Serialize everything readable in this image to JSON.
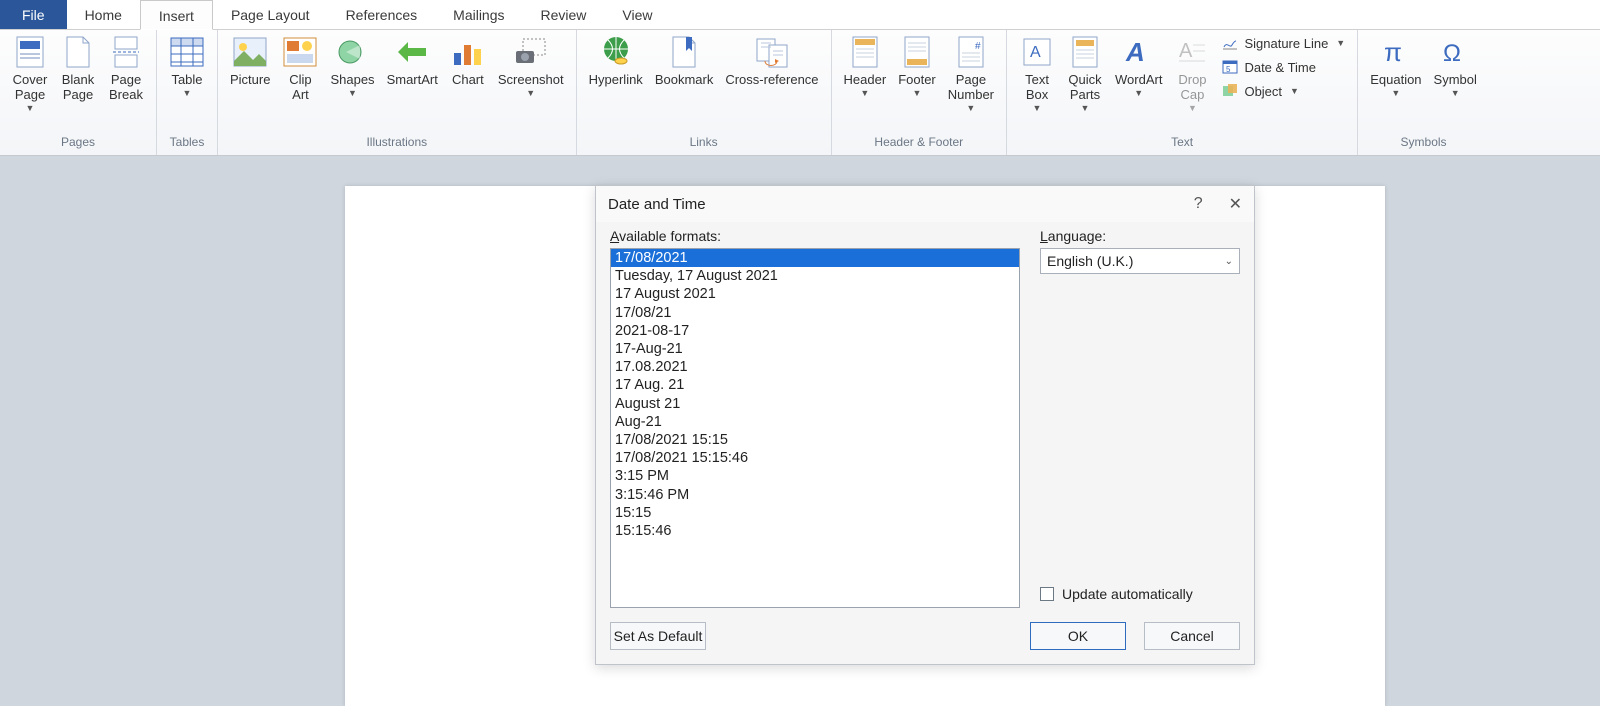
{
  "tabs": {
    "file": "File",
    "home": "Home",
    "insert": "Insert",
    "page_layout": "Page Layout",
    "references": "References",
    "mailings": "Mailings",
    "review": "Review",
    "view": "View"
  },
  "ribbon": {
    "pages": {
      "label": "Pages",
      "cover_page": "Cover\nPage",
      "blank_page": "Blank\nPage",
      "page_break": "Page\nBreak"
    },
    "tables": {
      "label": "Tables",
      "table": "Table"
    },
    "illustrations": {
      "label": "Illustrations",
      "picture": "Picture",
      "clip_art": "Clip\nArt",
      "shapes": "Shapes",
      "smartart": "SmartArt",
      "chart": "Chart",
      "screenshot": "Screenshot"
    },
    "links": {
      "label": "Links",
      "hyperlink": "Hyperlink",
      "bookmark": "Bookmark",
      "cross_ref": "Cross-reference"
    },
    "header_footer": {
      "label": "Header & Footer",
      "header": "Header",
      "footer": "Footer",
      "page_number": "Page\nNumber"
    },
    "text": {
      "label": "Text",
      "text_box": "Text\nBox",
      "quick_parts": "Quick\nParts",
      "wordart": "WordArt",
      "drop_cap": "Drop\nCap",
      "signature_line": "Signature Line",
      "date_time": "Date & Time",
      "object": "Object"
    },
    "symbols": {
      "label": "Symbols",
      "equation": "Equation",
      "symbol": "Symbol"
    }
  },
  "dialog": {
    "title": "Date and Time",
    "available_formats_label": "Available formats:",
    "language_label": "Language:",
    "language_value": "English (U.K.)",
    "update_auto": "Update automatically",
    "set_default": "Set As Default",
    "ok": "OK",
    "cancel": "Cancel",
    "formats": [
      "17/08/2021",
      "Tuesday, 17 August 2021",
      "17 August 2021",
      "17/08/21",
      "2021-08-17",
      "17-Aug-21",
      "17.08.2021",
      "17 Aug. 21",
      "August 21",
      "Aug-21",
      "17/08/2021 15:15",
      "17/08/2021 15:15:46",
      "3:15 PM",
      "3:15:46 PM",
      "15:15",
      "15:15:46"
    ],
    "selected_index": 0
  }
}
